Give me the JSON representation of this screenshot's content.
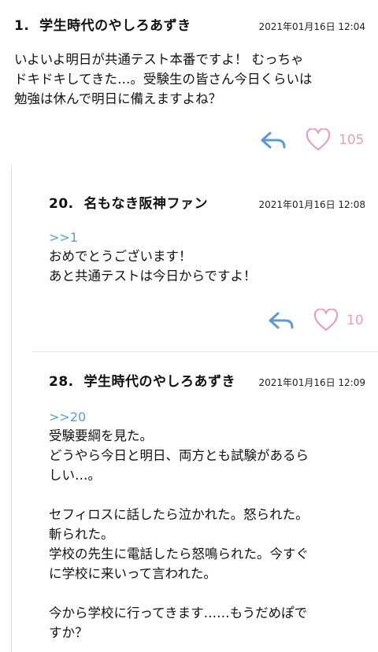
{
  "posts": [
    {
      "num": "1.",
      "author": "学生時代のやしろあずき",
      "date": "2021年01月16日 12:04",
      "anchor": "",
      "lines": [
        "いよいよ明日が共通テスト本番ですよ！ むっちゃ",
        "ドキドキしてきた…。受験生の皆さん今日くらいは",
        "勉強は休んで明日に備えますよね？"
      ],
      "likes": "105"
    },
    {
      "num": "20.",
      "author": "名もなき阪神ファン",
      "date": "2021年01月16日 12:08",
      "anchor": ">>1",
      "lines": [
        "おめでとうございます！",
        "あと共通テストは今日からですよ！"
      ],
      "likes": "10"
    },
    {
      "num": "28.",
      "author": "学生時代のやしろあずき",
      "date": "2021年01月16日 12:09",
      "anchor": ">>20",
      "lines": [
        "受験要綱を見た。",
        "どうやら今日と明日、両方とも試験があるら",
        "しい…。",
        " ",
        "セフィロスに話したら泣かれた。怒られた。",
        "斬られた。",
        "学校の先生に電話したら怒鳴られた。今すぐ",
        "に学校に来いって言われた。",
        " ",
        "今から学校に行ってきます……もうだめぽで",
        "すか？"
      ]
    }
  ],
  "colors": {
    "reply_icon": "#5b9bd5",
    "heart": "#e8a0b8",
    "anchor": "#5aa0cc"
  }
}
